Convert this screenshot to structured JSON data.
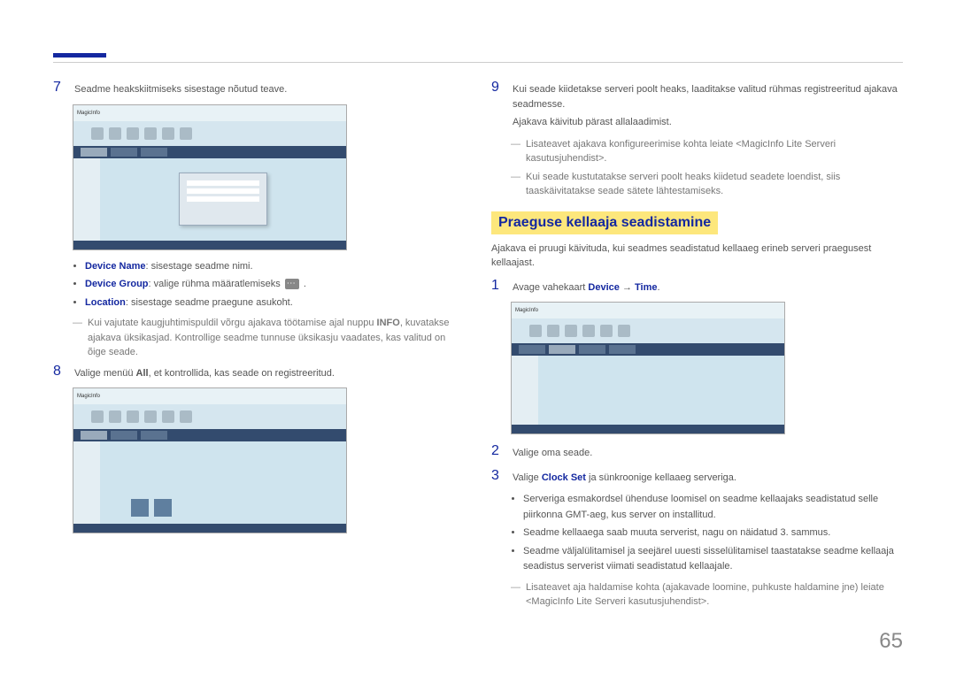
{
  "left": {
    "step7": {
      "num": "7",
      "text": "Seadme heakskiitmiseks sisestage nõutud teave."
    },
    "bullets7": {
      "deviceName": {
        "label": "Device Name",
        "text": ": sisestage seadme nimi."
      },
      "deviceGroup": {
        "label": "Device Group",
        "text": ": valige rühma määratlemiseks "
      },
      "location": {
        "label": "Location",
        "text": ": sisestage seadme praegune asukoht."
      }
    },
    "note7": {
      "prefix": "Kui vajutate kaugjuhtimispuldil võrgu ajakava töötamise ajal nuppu ",
      "info": "INFO",
      "mid": ", kuvatakse ajakava üksikasjad. Kontrollige seadme tunnuse üksikasju vaadates, kas valitud on õige seade."
    },
    "step8": {
      "num": "8",
      "text_prefix": "Valige menüü ",
      "all": "All",
      "text_suffix": ", et kontrollida, kas seade on registreeritud."
    },
    "screenshotLogo": "MagicInfo"
  },
  "right": {
    "step9": {
      "num": "9",
      "line1": "Kui seade kiidetakse serveri poolt heaks, laaditakse valitud rühmas registreeritud ajakava seadmesse.",
      "line2": "Ajakava käivitub pärast allalaadimist."
    },
    "note9a": "Lisateavet ajakava konfigureerimise kohta leiate <MagicInfo Lite Serveri kasutusjuhendist>.",
    "note9b": "Kui seade kustutatakse serveri poolt heaks kiidetud seadete loendist, siis taaskäivitatakse seade sätete lähtestamiseks.",
    "heading": "Praeguse kellaaja seadistamine",
    "intro": "Ajakava ei pruugi käivituda, kui seadmes seadistatud kellaaeg erineb serveri praegusest kellaajast.",
    "step1": {
      "num": "1",
      "text_prefix": "Avage vahekaart ",
      "device": "Device",
      "arrow": " → ",
      "time": "Time",
      "suffix": "."
    },
    "step2": {
      "num": "2",
      "text": "Valige oma seade."
    },
    "step3": {
      "num": "3",
      "text_prefix": "Valige ",
      "clockset": "Clock Set",
      "text_suffix": " ja sünkroonige kellaaeg serveriga."
    },
    "bullets3": {
      "a": "Serveriga esmakordsel ühenduse loomisel on seadme kellaajaks seadistatud selle piirkonna GMT-aeg, kus server on installitud.",
      "b": "Seadme kellaaega saab muuta serverist, nagu on näidatud 3. sammus.",
      "c": "Seadme väljalülitamisel ja seejärel uuesti sisselülitamisel taastatakse seadme kellaaja seadistus serverist viimati seadistatud kellaajale."
    },
    "note3": "Lisateavet aja haldamise kohta (ajakavade loomine, puhkuste haldamine jne) leiate <MagicInfo Lite Serveri kasutusjuhendist>."
  },
  "pageNumber": "65"
}
